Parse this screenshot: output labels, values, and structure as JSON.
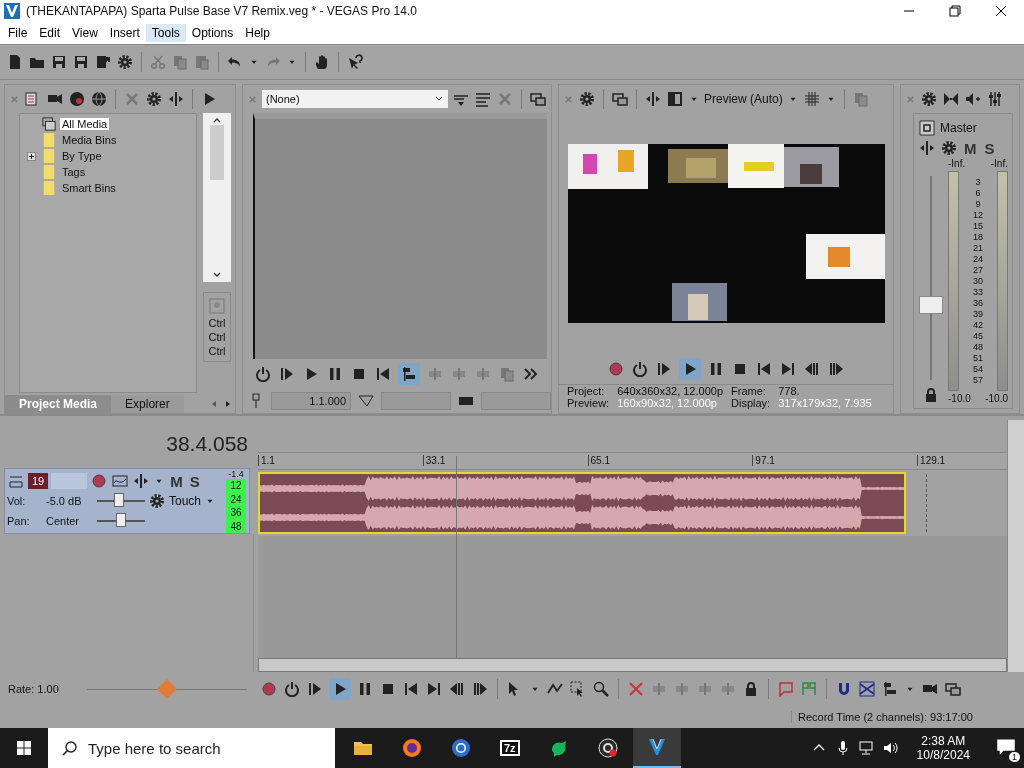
{
  "window": {
    "title": "(THEKANTAPAPA) Sparta Pulse Base V7 Remix.veg * - VEGAS Pro 14.0"
  },
  "menu": [
    {
      "label": "File",
      "selected": false
    },
    {
      "label": "Edit",
      "selected": false
    },
    {
      "label": "View",
      "selected": false
    },
    {
      "label": "Insert",
      "selected": false
    },
    {
      "label": "Tools",
      "selected": true
    },
    {
      "label": "Options",
      "selected": false
    },
    {
      "label": "Help",
      "selected": false
    }
  ],
  "media_panel": {
    "tree": [
      {
        "label": "All Media",
        "selected": true,
        "expandable": false
      },
      {
        "label": "Media Bins",
        "selected": false,
        "expandable": false
      },
      {
        "label": "By Type",
        "selected": false,
        "expandable": true
      },
      {
        "label": "Tags",
        "selected": false,
        "expandable": false
      },
      {
        "label": "Smart Bins",
        "selected": false,
        "expandable": false
      }
    ],
    "shortcuts": [
      "Ctrl",
      "Ctrl",
      "Ctrl"
    ],
    "tabs": [
      {
        "label": "Project Media",
        "selected": true
      },
      {
        "label": "Explorer",
        "selected": false
      }
    ]
  },
  "trimmer": {
    "source": "(None)",
    "time": "1.1.000"
  },
  "preview": {
    "quality": "Preview (Auto)",
    "play_active": true,
    "info_rows": [
      {
        "label": "Project:",
        "value": "640x360x32, 12.000p",
        "label_2": "Frame:",
        "value_2": "778."
      },
      {
        "label": "Preview:",
        "value": "160x90x32, 12.000p",
        "label_2": "Display:",
        "value_2": "317x179x32, 7.935"
      }
    ]
  },
  "master": {
    "title": "Master",
    "mute": "M",
    "solo": "S",
    "peaks": [
      "-Inf.",
      "-Inf."
    ],
    "scale": [
      "3",
      "6",
      "9",
      "12",
      "15",
      "18",
      "21",
      "24",
      "27",
      "30",
      "33",
      "36",
      "39",
      "42",
      "45",
      "48",
      "51",
      "54",
      "57"
    ],
    "fader": {
      "level": 0.37
    },
    "readings": [
      "-10.0",
      "-10.0"
    ]
  },
  "timeline": {
    "time": "38.4.058",
    "ruler": [
      "1.1",
      "33.1",
      "65.1",
      "97.1",
      "129.1"
    ],
    "track": {
      "selected": true,
      "number": "19",
      "mute": "M",
      "solo": "S",
      "peak": "-1.4",
      "meter_scale": [
        "12",
        "24",
        "36",
        "48"
      ],
      "volume_label": "Vol:",
      "volume": "-5.0 dB",
      "volume_slider": {
        "level": 0.45
      },
      "pan_label": "Pan:",
      "pan": "Center",
      "pan_slider": {
        "level": 0.5
      },
      "automation": "Touch"
    },
    "play_active": true,
    "rate": "Rate: 1.00",
    "rate_slider": {
      "level": 0.5
    },
    "status": "Record Time (2 channels): 93:17:00"
  },
  "taskbar": {
    "search": {
      "placeholder": "Type here to search"
    },
    "archive_label": "7z",
    "time": "2:38 AM",
    "date": "10/8/2024",
    "notifications": "1"
  }
}
